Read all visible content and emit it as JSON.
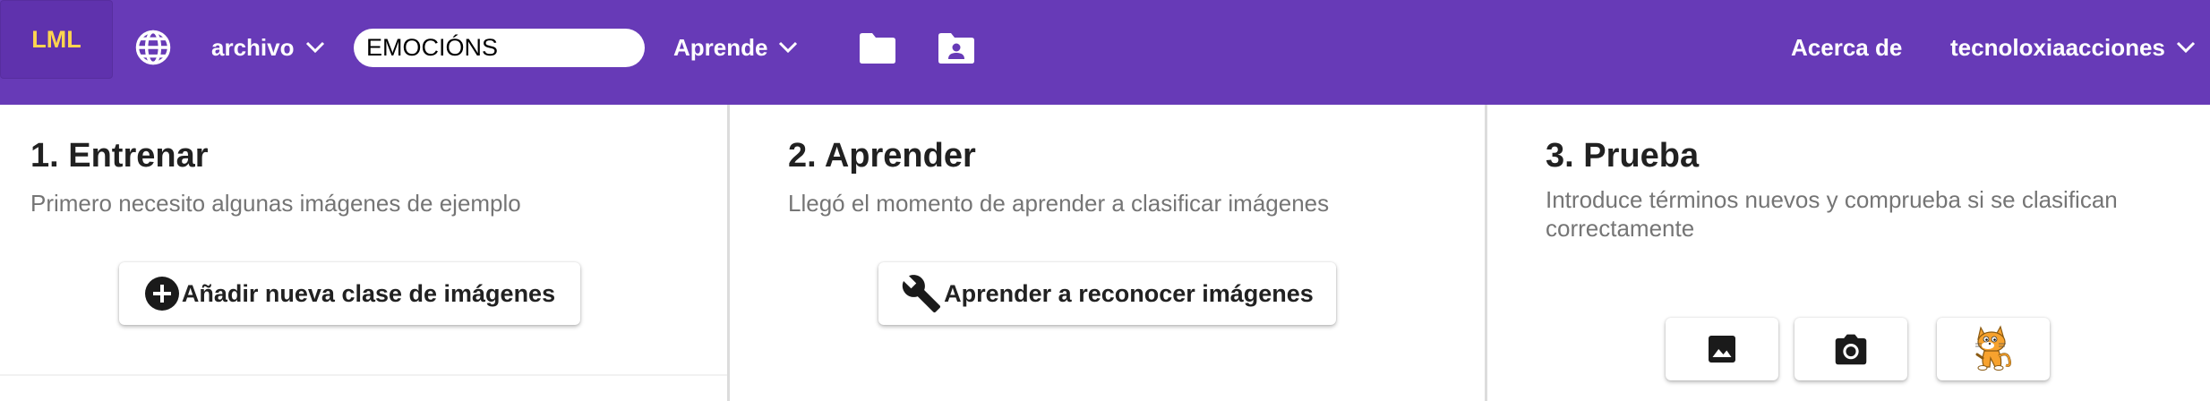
{
  "topbar": {
    "logo_label": "LML",
    "project_menu_label": "archivo",
    "project_name_value": "EMOCIÓNS",
    "learn_menu_label": "Aprende",
    "about_label": "Acerca de",
    "user_menu_label": "tecnoloxiaacciones",
    "bg_color": "#673ab7",
    "logo_color": "#ffd54f",
    "icons": [
      "globe-icon",
      "chevron-down-icon",
      "folder-icon",
      "folder-user-icon"
    ]
  },
  "train": {
    "title": "1. Entrenar",
    "subtitle": "Primero necesito algunas imágenes de ejemplo",
    "add_class_label": "Añadir nueva clase de imágenes"
  },
  "learn": {
    "title": "2. Aprender",
    "subtitle": "Llegó el momento de aprender a clasificar imágenes",
    "learn_button_label": "Aprender a reconocer imágenes"
  },
  "test": {
    "title": "3. Prueba",
    "subtitle": "Introduce términos nuevos y comprueba si se clasifican correctamente",
    "buttons": [
      "image-icon",
      "camera-icon",
      "scratch-cat-icon"
    ]
  }
}
